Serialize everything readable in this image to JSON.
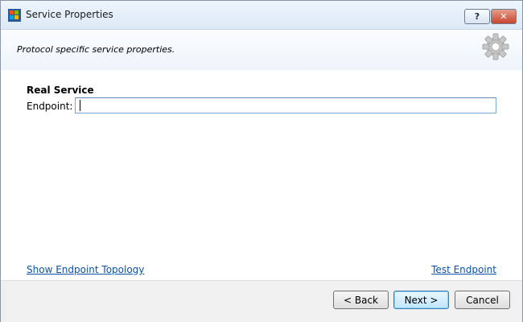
{
  "window": {
    "title": "Service Properties",
    "app_icon": "windows-app-icon",
    "help_label": "?",
    "close_label": "✕"
  },
  "header": {
    "subtitle": "Protocol specific service properties.",
    "icon": "gear-icon"
  },
  "form": {
    "section_title": "Real Service",
    "endpoint_label": "Endpoint:",
    "endpoint_value": ""
  },
  "links": {
    "show_topology": "Show Endpoint Topology",
    "test_endpoint": "Test Endpoint"
  },
  "buttons": {
    "back": "< Back",
    "next": "Next >",
    "cancel": "Cancel"
  },
  "colors": {
    "link": "#0a52a8",
    "close_button": "#c8452c",
    "input_border": "#7aa7d0"
  }
}
